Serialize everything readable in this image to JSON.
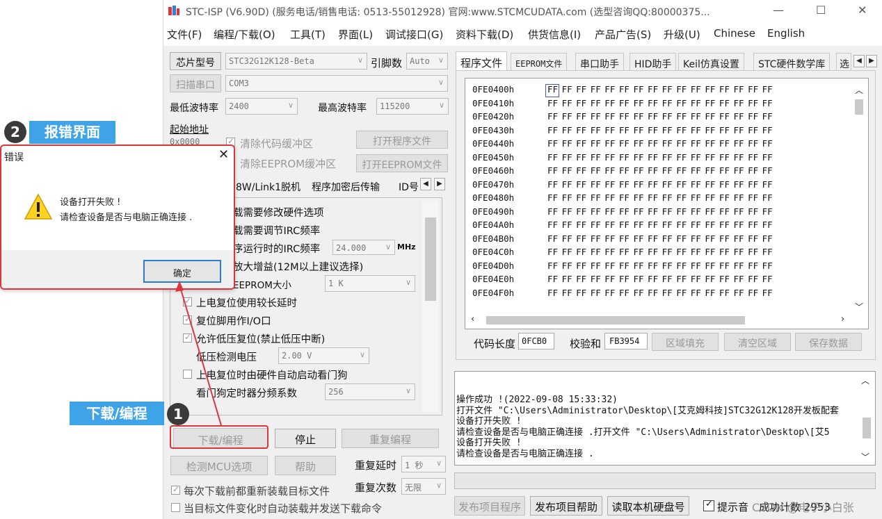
{
  "window": {
    "title": "STC-ISP (V6.90D) (服务电话/销售电话: 0513-55012928) 官网:www.STCMCUDATA.com  (选型咨询QQ:80000375...",
    "min": "—",
    "max": "☐",
    "close": "✕"
  },
  "menu": [
    "文件(F)",
    "编程/下载(O)",
    "工具(T)",
    "界面(L)",
    "调试接口(G)",
    "资料下载(D)",
    "供货信息(I)",
    "产品广告(S)",
    "升级(U)",
    "Chinese",
    "English"
  ],
  "left": {
    "chip_btn": "芯片型号",
    "chip_value": "STC32G12K128-Beta",
    "pin_label": "引脚数",
    "pin_value": "Auto",
    "scan_btn": "扫描串口",
    "port_value": "COM3",
    "min_baud_label": "最低波特率",
    "min_baud": "2400",
    "max_baud_label": "最高波特率",
    "max_baud": "115200",
    "start_addr_label": "起始地址",
    "start_addr": "0x0000",
    "clear_code": "清除代码缓冲区",
    "open_prog": "打开程序文件",
    "clear_eeprom": "清除EEPROM缓冲区",
    "open_eeprom": "打开EEPROM文件",
    "subtabs": [
      "8W/Link1脱机",
      "程序加密后传输",
      "ID号"
    ],
    "options": [
      "载需要修改硬件选项",
      "载需要调节IRC频率",
      "序运行时的IRC频率",
      "放大增益(12M以上建议选择)",
      "EEPROM大小",
      "上电复位使用较长延时",
      "复位脚用作I/O口",
      "允许低压复位(禁止低压中断)",
      "低压检测电压",
      "上电复位时由硬件自动启动看门狗",
      "看门狗定时器分频系数"
    ],
    "irc_freq": "24.000",
    "irc_unit": "MHz",
    "eeprom_size": "1   K",
    "low_volt": "2.00 V",
    "wdt_div": "256",
    "download_btn": "下载/编程",
    "stop_btn": "停止",
    "reprogram_btn": "重复编程",
    "check_mcu_btn": "检测MCU选项",
    "help_btn": "帮助",
    "repeat_delay_label": "重复延时",
    "repeat_delay": "1 秒",
    "repeat_count_label": "重复次数",
    "repeat_count": "无限",
    "reload_each": "每次下载前都重新装载目标文件",
    "auto_reload": "当目标文件变化时自动装载并发送下载命令"
  },
  "right": {
    "tabs": [
      "程序文件",
      "EEPROM文件",
      "串口助手",
      "HID助手",
      "Keil仿真设置",
      "STC硬件数学库",
      "选"
    ],
    "hex_rows": [
      {
        "addr": "0FE0400h",
        "bytes": "FF FF FF FF FF FF FF FF FF FF FF FF FF FF FF FF"
      },
      {
        "addr": "0FE0410h",
        "bytes": "FF FF FF FF FF FF FF FF FF FF FF FF FF FF FF FF"
      },
      {
        "addr": "0FE0420h",
        "bytes": "FF FF FF FF FF FF FF FF FF FF FF FF FF FF FF FF"
      },
      {
        "addr": "0FE0430h",
        "bytes": "FF FF FF FF FF FF FF FF FF FF FF FF FF FF FF FF"
      },
      {
        "addr": "0FE0440h",
        "bytes": "FF FF FF FF FF FF FF FF FF FF FF FF FF FF FF FF"
      },
      {
        "addr": "0FE0450h",
        "bytes": "FF FF FF FF FF FF FF FF FF FF FF FF FF FF FF FF"
      },
      {
        "addr": "0FE0460h",
        "bytes": "FF FF FF FF FF FF FF FF FF FF FF FF FF FF FF FF"
      },
      {
        "addr": "0FE0470h",
        "bytes": "FF FF FF FF FF FF FF FF FF FF FF FF FF FF FF FF"
      },
      {
        "addr": "0FE0480h",
        "bytes": "FF FF FF FF FF FF FF FF FF FF FF FF FF FF FF FF"
      },
      {
        "addr": "0FE0490h",
        "bytes": "FF FF FF FF FF FF FF FF FF FF FF FF FF FF FF FF"
      },
      {
        "addr": "0FE04A0h",
        "bytes": "FF FF FF FF FF FF FF FF FF FF FF FF FF FF FF FF"
      },
      {
        "addr": "0FE04B0h",
        "bytes": "FF FF FF FF FF FF FF FF FF FF FF FF FF FF FF FF"
      },
      {
        "addr": "0FE04C0h",
        "bytes": "FF FF FF FF FF FF FF FF FF FF FF FF FF FF FF FF"
      },
      {
        "addr": "0FE04D0h",
        "bytes": "FF FF FF FF FF FF FF FF FF FF FF FF FF FF FF FF"
      },
      {
        "addr": "0FE04E0h",
        "bytes": "FF FF FF FF FF FF FF FF FF FF FF FF FF FF FF FF"
      },
      {
        "addr": "0FE04F0h",
        "bytes": "FF FF FF FF FF FF FF FF FF FF FF FF FF FF FF FF"
      }
    ],
    "code_len_label": "代码长度",
    "code_len": "0FCB0",
    "checksum_label": "校验和",
    "checksum": "FB3954",
    "fill_btn": "区域填充",
    "clear_btn": "清空区域",
    "save_btn": "保存数据",
    "log_lines": [
      "操作成功 !(2022-09-08 15:33:32)",
      "打开文件 \"C:\\Users\\Administrator\\Desktop\\[艾克姆科技]STC32G12K128开发板配套",
      "设备打开失败 !",
      "请检查设备是否与电脑正确连接 .打开文件 \"C:\\Users\\Administrator\\Desktop\\[艾5",
      "设备打开失败 !",
      "请检查设备是否与电脑正确连接 ."
    ],
    "publish_prog": "发布项目程序",
    "publish_help": "发布项目帮助",
    "read_disk": "读取本机硬盘号",
    "prompt_sound": "提示音",
    "success_count": "成功计数 2953",
    "watermark": "CSDN @电子小白张"
  },
  "dialog": {
    "title": "错误",
    "line1": "设备打开失败 !",
    "line2": "请检查设备是否与电脑正确连接 .",
    "ok": "确定"
  },
  "annotations": {
    "n1": "1",
    "t1": "下载/编程",
    "n2": "2",
    "t2": "报错界面"
  },
  "colors": {
    "accent_blue": "#3fa3e8",
    "annotation_red": "#d9363e",
    "dark_circle": "#3a3a3a"
  }
}
